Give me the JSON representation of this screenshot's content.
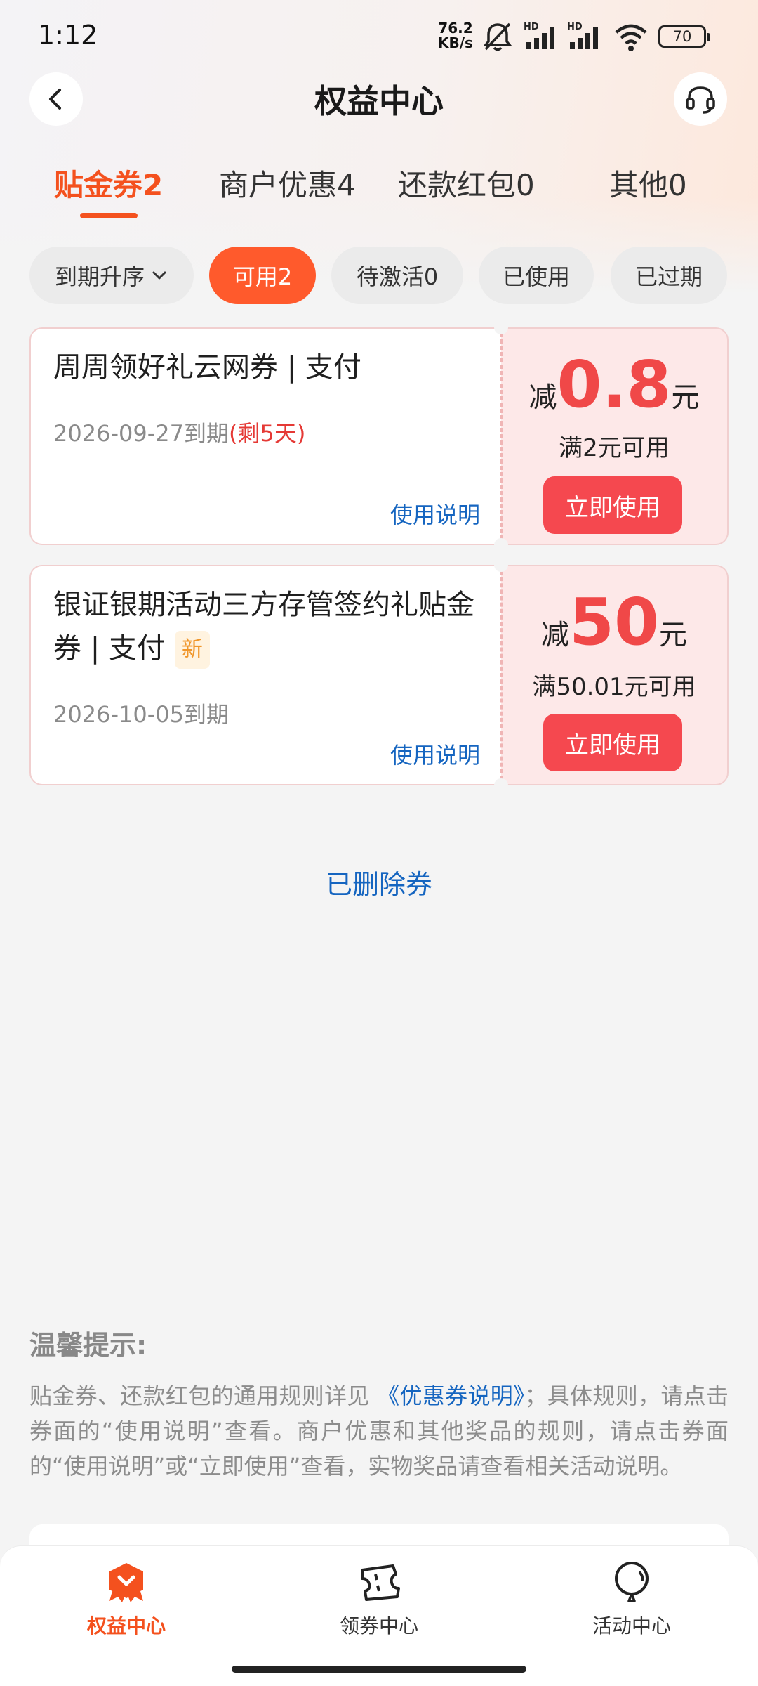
{
  "status_bar": {
    "time": "1:12",
    "net_speed_value": "76.2",
    "net_speed_unit": "KB/s",
    "battery": "70",
    "icons": [
      "mute-icon",
      "signal-hd-icon",
      "signal-hd-icon",
      "wifi-icon",
      "battery-icon"
    ]
  },
  "header": {
    "title": "权益中心",
    "back_icon": "chevron-left-icon",
    "service_icon": "headset-icon"
  },
  "tabs": [
    {
      "label": "贴金券2",
      "active": true
    },
    {
      "label": "商户优惠4",
      "active": false
    },
    {
      "label": "还款红包0",
      "active": false
    },
    {
      "label": "其他0",
      "active": false
    }
  ],
  "filters": [
    {
      "label": "到期升序",
      "active": false,
      "has_dropdown": true
    },
    {
      "label": "可用2",
      "active": true
    },
    {
      "label": "待激活0",
      "active": false
    },
    {
      "label": "已使用",
      "active": false
    },
    {
      "label": "已过期",
      "active": false
    }
  ],
  "coupons": [
    {
      "title": "周周领好礼云网券 | 支付",
      "expiry": "2026-09-27到期",
      "remaining": "(剩5天)",
      "usage_link": "使用说明",
      "amount_prefix": "减",
      "amount_value": "0.8",
      "amount_unit": "元",
      "threshold": "满2元可用",
      "use_button": "立即使用"
    },
    {
      "title": "银证银期活动三方存管签约礼贴金券 | 支付",
      "badge": "新",
      "expiry": "2026-10-05到期",
      "usage_link": "使用说明",
      "amount_prefix": "减",
      "amount_value": "50",
      "amount_unit": "元",
      "threshold": "满50.01元可用",
      "use_button": "立即使用"
    }
  ],
  "deleted_link": "已删除券",
  "tips": {
    "title": "温馨提示:",
    "text_before_link": "贴金券、还款红包的通用规则详见 ",
    "link": "《优惠券说明》",
    "text_after_link": "；具体规则，请点击券面的“使用说明”查看。商户优惠和其他奖品的规则，请点击券面的“使用说明”或“立即使用”查看，实物奖品请查看相关活动说明。"
  },
  "bottom_nav": [
    {
      "label": "权益中心",
      "icon": "benefits-badge-icon",
      "active": true
    },
    {
      "label": "领券中心",
      "icon": "ticket-icon",
      "active": false
    },
    {
      "label": "活动中心",
      "icon": "balloon-icon",
      "active": false
    }
  ],
  "colors": {
    "accent": "#f4511e",
    "coupon_red": "#f04848",
    "link_blue": "#1565c0",
    "coupon_right_bg": "#fde8e8"
  }
}
